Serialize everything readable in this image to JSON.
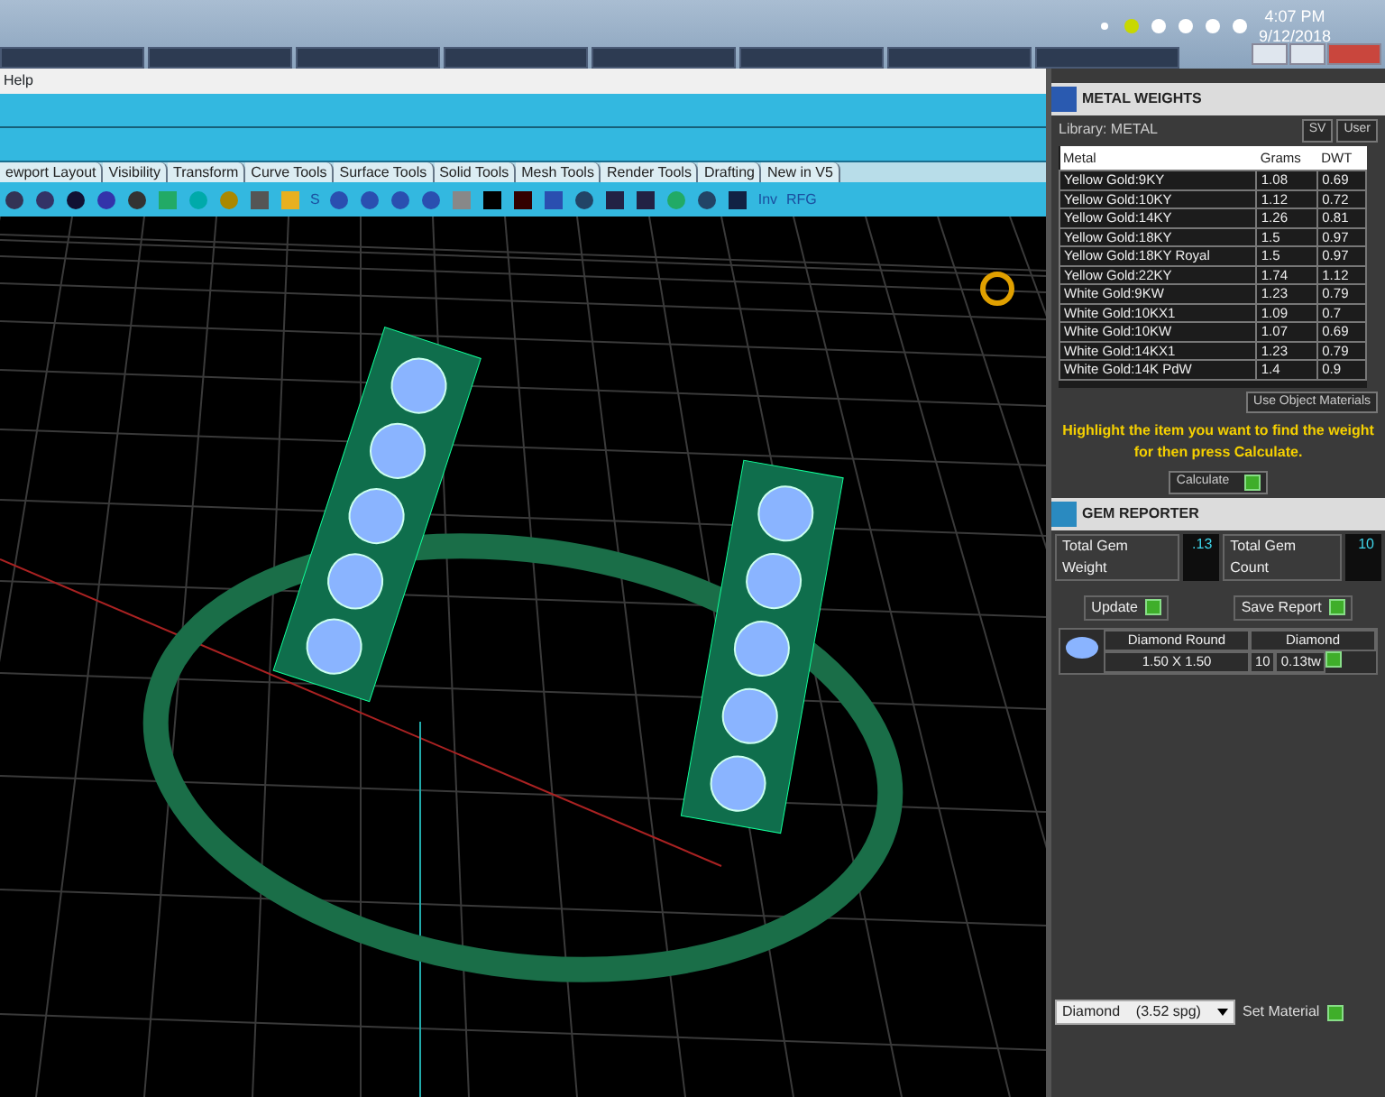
{
  "taskbar": {
    "time": "4:07 PM",
    "date": "9/12/2018"
  },
  "menu": [
    "Help"
  ],
  "tabs": [
    "ewport Layout",
    "Visibility",
    "Transform",
    "Curve Tools",
    "Surface Tools",
    "Solid Tools",
    "Mesh Tools",
    "Render Tools",
    "Drafting",
    "New in V5"
  ],
  "toolbar_labels": [
    "S",
    "Inv",
    "RFG"
  ],
  "metal_weights": {
    "title": "METAL WEIGHTS",
    "library": "Library: METAL",
    "toggles": [
      "SV",
      "User"
    ],
    "columns": [
      "Metal",
      "Grams",
      "DWT"
    ],
    "rows": [
      [
        "Yellow Gold:9KY",
        "1.08",
        "0.69"
      ],
      [
        "Yellow Gold:10KY",
        "1.12",
        "0.72"
      ],
      [
        "Yellow Gold:14KY",
        "1.26",
        "0.81"
      ],
      [
        "Yellow Gold:18KY",
        "1.5",
        "0.97"
      ],
      [
        "Yellow Gold:18KY Royal",
        "1.5",
        "0.97"
      ],
      [
        "Yellow Gold:22KY",
        "1.74",
        "1.12"
      ],
      [
        "White Gold:9KW",
        "1.23",
        "0.79"
      ],
      [
        "White Gold:10KX1",
        "1.09",
        "0.7"
      ],
      [
        "White Gold:10KW",
        "1.07",
        "0.69"
      ],
      [
        "White Gold:14KX1",
        "1.23",
        "0.79"
      ],
      [
        "White Gold:14K PdW",
        "1.4",
        "0.9"
      ]
    ],
    "use_object_materials": "Use Object Materials",
    "hint": "Highlight the item you want to find the weight for then press Calculate.",
    "action": "Calculate"
  },
  "gem_reporter": {
    "title": "GEM REPORTER",
    "weight_label": "Total Gem Weight",
    "weight": ".13",
    "count_label": "Total Gem Count",
    "count": "10",
    "buttons": [
      "Update",
      "Save Report"
    ],
    "gem": {
      "shape": "Diamond Round",
      "material": "Diamond",
      "size": "1.50 X 1.50",
      "count": "10",
      "weight": "0.13tw"
    }
  },
  "material": {
    "value": "Diamond    (3.52 spg)",
    "button": "Set Material"
  }
}
